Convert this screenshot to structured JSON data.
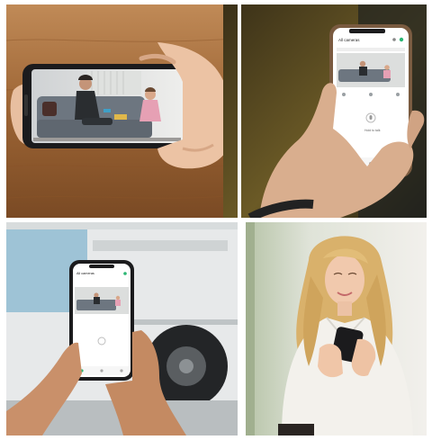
{
  "colors": {
    "wood": "#a0683a",
    "wood_dark": "#6f4220",
    "phone_frame": "#1b1b1d",
    "app_bg": "#ffffff",
    "app_accent": "#2bb673",
    "sofa": "#6d7680",
    "desk": "#3a3530",
    "bus_white": "#e7e9ea",
    "bus_window": "#9ec3d6",
    "wall_white": "#f2f0ec",
    "hair": "#d9b16b",
    "shirt": "#f3f1ec"
  },
  "icons": {
    "app_home": "home-icon",
    "app_settings": "settings-icon",
    "app_add": "plus-icon",
    "app_talk": "microphone-icon",
    "app_playback": "playback-icon"
  },
  "phone_ui": {
    "header_title": "All cameras",
    "camera_name": "",
    "talk_label": "Hold to talk"
  }
}
